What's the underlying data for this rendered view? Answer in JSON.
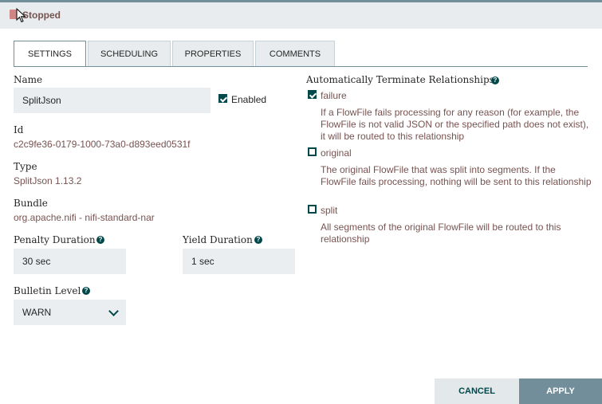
{
  "status": {
    "text": "Stopped",
    "icon": "stopped-icon"
  },
  "tabs": [
    {
      "label": "SETTINGS",
      "active": true
    },
    {
      "label": "SCHEDULING",
      "active": false
    },
    {
      "label": "PROPERTIES",
      "active": false
    },
    {
      "label": "COMMENTS",
      "active": false
    }
  ],
  "settings": {
    "name_label": "Name",
    "name_value": "SplitJson",
    "enabled_label": "Enabled",
    "enabled": true,
    "id_label": "Id",
    "id_value": "c2c9fe36-0179-1000-73a0-d893eed0531f",
    "type_label": "Type",
    "type_value": "SplitJson 1.13.2",
    "bundle_label": "Bundle",
    "bundle_value": "org.apache.nifi - nifi-standard-nar",
    "penalty_label": "Penalty Duration",
    "penalty_value": "30 sec",
    "yield_label": "Yield Duration",
    "yield_value": "1 sec",
    "bulletin_label": "Bulletin Level",
    "bulletin_value": "WARN"
  },
  "relationships": {
    "title": "Automatically Terminate Relationships",
    "items": [
      {
        "name": "failure",
        "checked": true,
        "description": "If a FlowFile fails processing for any reason (for example, the FlowFile is not valid JSON or the specified path does not exist), it will be routed to this relationship"
      },
      {
        "name": "original",
        "checked": false,
        "description": "The original FlowFile that was split into segments. If the FlowFile fails processing, nothing will be sent to this relationship"
      },
      {
        "name": "split",
        "checked": false,
        "description": "All segments of the original FlowFile will be routed to this relationship"
      }
    ]
  },
  "buttons": {
    "cancel": "CANCEL",
    "apply": "APPLY"
  },
  "colors": {
    "accent": "#004849",
    "value_text": "#775351",
    "header_bg": "#e8ecee",
    "apply_bg": "#728e9b"
  }
}
